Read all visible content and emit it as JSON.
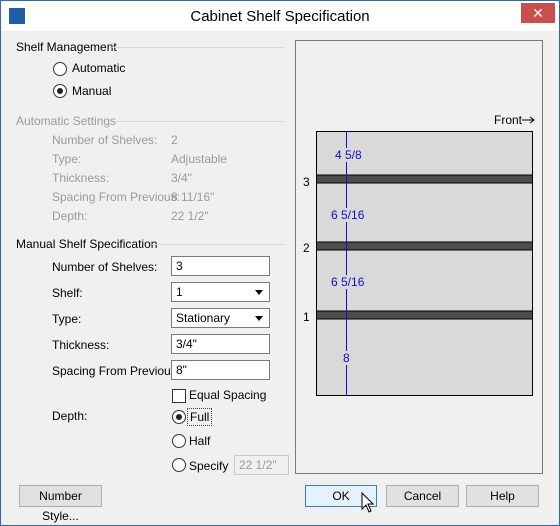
{
  "dialog": {
    "title": "Cabinet Shelf Specification",
    "close_symbol": "✕"
  },
  "shelf_management": {
    "heading": "Shelf Management",
    "options": [
      {
        "label": "Automatic",
        "selected": false
      },
      {
        "label": "Manual",
        "selected": true
      }
    ]
  },
  "automatic_settings": {
    "heading": "Automatic Settings",
    "rows": [
      {
        "label": "Number of Shelves:",
        "value": "2"
      },
      {
        "label": "Type:",
        "value": "Adjustable"
      },
      {
        "label": "Thickness:",
        "value": "3/4\""
      },
      {
        "label": "Spacing From Previous:",
        "value": "8 11/16\""
      },
      {
        "label": "Depth:",
        "value": "22 1/2\""
      }
    ]
  },
  "manual_spec": {
    "heading": "Manual Shelf Specification",
    "number_of_shelves_label": "Number of Shelves:",
    "number_of_shelves_value": "3",
    "shelf_label": "Shelf:",
    "shelf_value": "1",
    "type_label": "Type:",
    "type_value": "Stationary",
    "thickness_label": "Thickness:",
    "thickness_value": "3/4\"",
    "spacing_label": "Spacing From Previous:",
    "spacing_value": "8\"",
    "equal_spacing_label": "Equal Spacing",
    "equal_spacing_checked": false,
    "depth_label": "Depth:",
    "depth_options": [
      {
        "label": "Full",
        "selected": true
      },
      {
        "label": "Half",
        "selected": false
      },
      {
        "label": "Specify",
        "selected": false
      }
    ],
    "specify_value": "22 1/2\""
  },
  "preview": {
    "front_label": "Front",
    "shelf_numbers": [
      "3",
      "2",
      "1"
    ],
    "dimensions": [
      "4 5/8",
      "6 5/16",
      "6 5/16",
      "8"
    ]
  },
  "buttons": {
    "number_style": "Number Style...",
    "ok": "OK",
    "cancel": "Cancel",
    "help": "Help"
  },
  "colors": {
    "dimension_text": "#1010c8",
    "shelf_fill": "#4d4d4d",
    "cabinet_fill": "#d9d9d9"
  }
}
